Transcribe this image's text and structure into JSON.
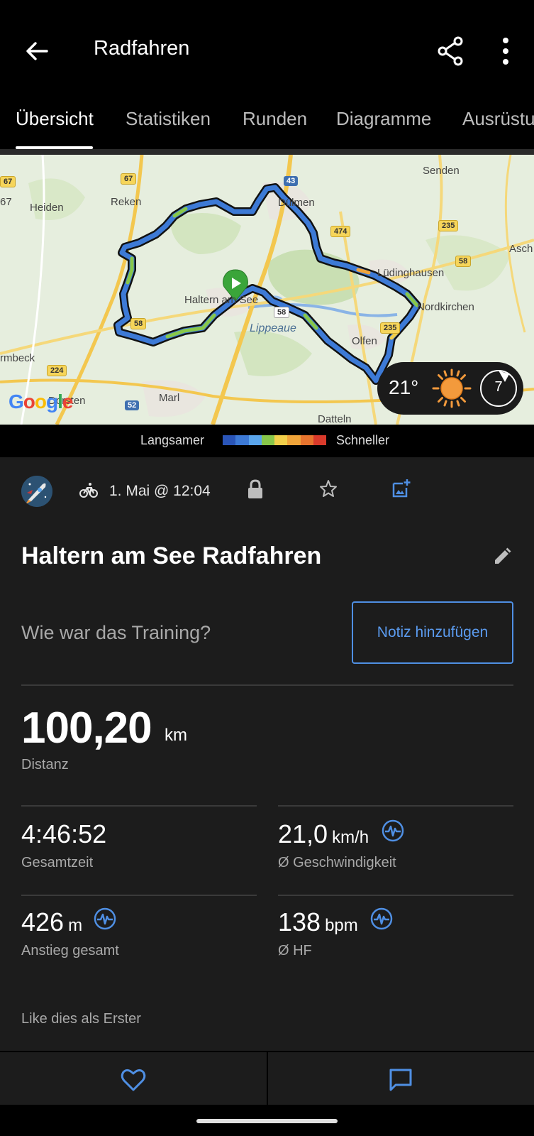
{
  "appbar": {
    "title": "Radfahren",
    "icons": [
      "back-arrow-icon",
      "share-icon",
      "more-vert-icon"
    ]
  },
  "tabs": [
    {
      "label": "Übersicht",
      "active": true
    },
    {
      "label": "Statistiken",
      "active": false
    },
    {
      "label": "Runden",
      "active": false
    },
    {
      "label": "Diagramme",
      "active": false
    },
    {
      "label": "Ausrüstu",
      "active": false
    }
  ],
  "map": {
    "labels": [
      "Senden",
      "Heiden",
      "Reken",
      "Dülmen",
      "Asch",
      "Lüdinghausen",
      "Haltern am See",
      "Nordkirchen",
      "Lippeaue",
      "Olfen",
      "rmbeck",
      "Marl",
      "Datteln",
      "en",
      "67",
      "Dorsten"
    ],
    "road_numbers": [
      "67",
      "43",
      "474",
      "235",
      "58",
      "58",
      "58",
      "235",
      "224",
      "52",
      "67"
    ],
    "google_logo": "Google",
    "weather": {
      "temperature": "21°",
      "wind": "7",
      "icons": [
        "sun-icon",
        "wind-icon"
      ]
    }
  },
  "legend": {
    "slow_label": "Langsamer",
    "fast_label": "Schneller",
    "colors": [
      "#2a55b8",
      "#3d7ad6",
      "#5aa5ec",
      "#88c74a",
      "#f2cf4a",
      "#f0a43a",
      "#e7742e",
      "#d93a2b"
    ]
  },
  "meta": {
    "datetime": "1. Mai @ 12:04",
    "icons": [
      "avatar-rocket-icon",
      "bike-icon",
      "lock-icon",
      "star-icon",
      "add-photo-icon"
    ]
  },
  "activity": {
    "name": "Haltern am See Radfahren",
    "question": "Wie war das Training?",
    "note_button": "Notiz hinzufügen"
  },
  "distance": {
    "value": "100,20",
    "unit": "km",
    "label": "Distanz"
  },
  "stats": [
    {
      "value": "4:46:52",
      "unit": "",
      "label": "Gesamtzeit",
      "pulse": false
    },
    {
      "value": "21,0",
      "unit": "km/h",
      "label": "Ø Geschwindigkeit",
      "pulse": true
    },
    {
      "value": "426",
      "unit": "m",
      "label": "Anstieg gesamt",
      "pulse": true
    },
    {
      "value": "138",
      "unit": "bpm",
      "label": "Ø HF",
      "pulse": true
    }
  ],
  "like_text": "Like dies als Erster",
  "colors": {
    "accent": "#4f8fe3",
    "background": "#1c1c1c",
    "header": "#000000"
  }
}
